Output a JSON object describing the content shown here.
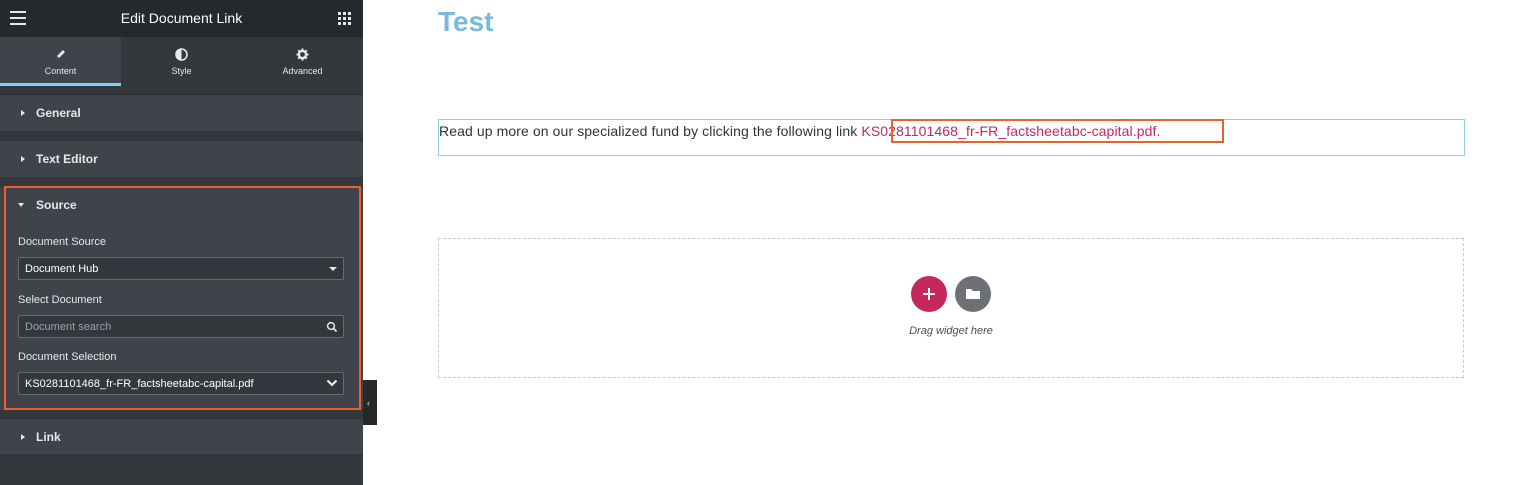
{
  "panel": {
    "title": "Edit Document Link",
    "tabs": [
      {
        "label": "Content",
        "icon": "pencil-icon",
        "active": true
      },
      {
        "label": "Style",
        "icon": "half-circle-icon",
        "active": false
      },
      {
        "label": "Advanced",
        "icon": "gear-icon",
        "active": false
      }
    ],
    "sections": {
      "general": "General",
      "text_editor": "Text Editor",
      "source": "Source",
      "link": "Link"
    },
    "source": {
      "document_source_label": "Document Source",
      "document_source_value": "Document Hub",
      "select_document_label": "Select Document",
      "search_placeholder": "Document search",
      "document_selection_label": "Document Selection",
      "document_selection_value": "KS0281101468_fr-FR_factsheetabc-capital.pdf"
    }
  },
  "canvas": {
    "page_title": "Test",
    "body_text": "Read up more on our specialized fund by clicking the following link ",
    "link_text": "KS0281101468_fr-FR_factsheetabc-capital.pdf.",
    "drag_text": "Drag widget here"
  },
  "colors": {
    "accent": "#c4285c",
    "highlight": "#e8632b",
    "tab_indicator": "#71d7f7",
    "title": "#7ab8dd"
  }
}
